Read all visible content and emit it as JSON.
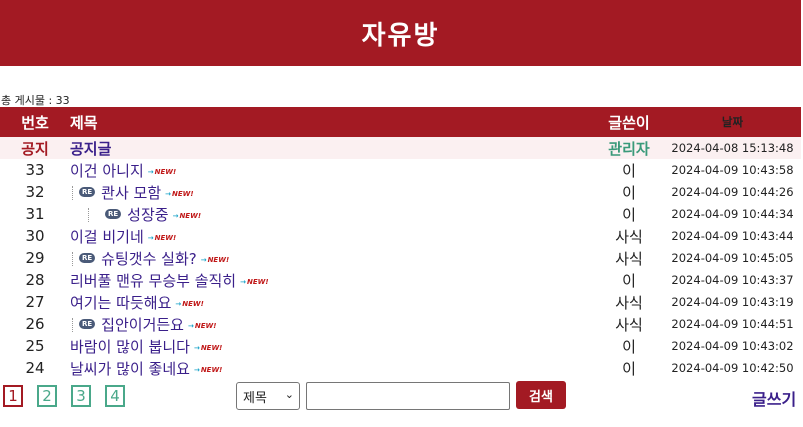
{
  "header": {
    "title": "자유방"
  },
  "board": {
    "total_label": "총 게시물 : 33",
    "columns": {
      "num": "번호",
      "title": "제목",
      "author": "글쓴이",
      "date": "날짜"
    },
    "notice": {
      "num": "공지",
      "title": "공지글",
      "author": "관리자",
      "date": "2024-04-08 15:13:48"
    },
    "rows": [
      {
        "num": "33",
        "title": "이건 아니지",
        "author": "이",
        "date": "2024-04-09 10:43:58",
        "new": "NEW!",
        "reply": 0
      },
      {
        "num": "32",
        "title": "콴사 모함",
        "author": "이",
        "date": "2024-04-09 10:44:26",
        "new": "NEW!",
        "reply": 1,
        "re": "RE"
      },
      {
        "num": "31",
        "title": "성장중",
        "author": "이",
        "date": "2024-04-09 10:44:34",
        "new": "NEW!",
        "reply": 2,
        "re": "RE"
      },
      {
        "num": "30",
        "title": "이걸 비기네",
        "author": "사식",
        "date": "2024-04-09 10:43:44",
        "new": "NEW!",
        "reply": 0
      },
      {
        "num": "29",
        "title": "슈팅갯수 실화?",
        "author": "사식",
        "date": "2024-04-09 10:45:05",
        "new": "NEW!",
        "reply": 1,
        "re": "RE"
      },
      {
        "num": "28",
        "title": "리버풀 맨유 무승부 솔직히",
        "author": "이",
        "date": "2024-04-09 10:43:37",
        "new": "NEW!",
        "reply": 0
      },
      {
        "num": "27",
        "title": "여기는 따듯해요",
        "author": "사식",
        "date": "2024-04-09 10:43:19",
        "new": "NEW!",
        "reply": 0
      },
      {
        "num": "26",
        "title": "집안이거든요",
        "author": "사식",
        "date": "2024-04-09 10:44:51",
        "new": "NEW!",
        "reply": 1,
        "re": "RE"
      },
      {
        "num": "25",
        "title": "바람이 많이 붑니다",
        "author": "이",
        "date": "2024-04-09 10:43:02",
        "new": "NEW!",
        "reply": 0
      },
      {
        "num": "24",
        "title": "날씨가 많이 좋네요",
        "author": "이",
        "date": "2024-04-09 10:42:50",
        "new": "NEW!",
        "reply": 0
      }
    ]
  },
  "pagination": {
    "pages": [
      "1",
      "2",
      "3",
      "4"
    ],
    "current": "1"
  },
  "search": {
    "field_selected": "제목",
    "query": "",
    "button_label": "검색"
  },
  "write_label": "글쓰기",
  "colors": {
    "brand": "#a31a23",
    "link": "#3a1f8a",
    "accent": "#4aa88a"
  }
}
